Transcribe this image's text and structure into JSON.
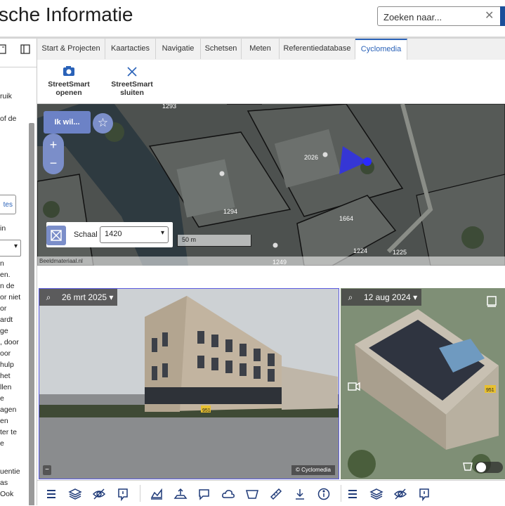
{
  "header": {
    "title": "sche Informatie",
    "search_placeholder": "Zoeken naar...",
    "clear_symbol": "✕"
  },
  "left_panel": {
    "lines": [
      "ruik",
      "of de",
      "in",
      "n",
      "en.",
      "n de",
      "or niet",
      "or",
      "ardt",
      "ge",
      ", door",
      "oor",
      "hulp",
      "het",
      "llen",
      "e",
      "agen",
      "en",
      "ter te",
      "e",
      "uentie",
      "as",
      "Ook"
    ],
    "button_label": "tes",
    "select_symbol": "▾"
  },
  "tabs": [
    {
      "label": "Start & Projecten",
      "active": false
    },
    {
      "label": "Kaartacties",
      "active": false
    },
    {
      "label": "Navigatie",
      "active": false
    },
    {
      "label": "Schetsen",
      "active": false
    },
    {
      "label": "Meten",
      "active": false
    },
    {
      "label": "Referentiedatabase",
      "active": false
    },
    {
      "label": "Cyclomedia",
      "active": true
    }
  ],
  "ribbon": {
    "open": {
      "line1": "StreetSmart",
      "line2": "openen",
      "icon": "camera-icon"
    },
    "close": {
      "line1": "StreetSmart",
      "line2": "sluiten",
      "icon": "close-icon"
    }
  },
  "map": {
    "ikwil_label": "Ik wil...",
    "zoom_in": "+",
    "zoom_out": "−",
    "scale_label": "Schaal",
    "scale_value": "1420",
    "scalebar_label": "50 m",
    "attribution": "Beeldmateriaal.nl",
    "parcels": [
      "1293",
      "2026",
      "1294",
      "1664",
      "1224",
      "1225",
      "1249"
    ]
  },
  "photos": {
    "left_date": "26 mrt 2025",
    "right_date": "12 aug 2024",
    "credit": "© Cyclomedia",
    "minus": "−",
    "marker": "951"
  },
  "toolbar_icons": [
    "menu-icon",
    "layers-icon",
    "visibility-off-icon",
    "report-icon",
    "chart-icon",
    "export-icon",
    "comment-icon",
    "cloud-icon",
    "area-icon",
    "ruler-icon",
    "download-icon",
    "info-icon",
    "menu-icon",
    "layers-icon",
    "visibility-off-icon",
    "report-icon"
  ],
  "colors": {
    "accent": "#2a62b8",
    "button": "#6c82c6",
    "toolbar_icon": "#1f3a78"
  }
}
